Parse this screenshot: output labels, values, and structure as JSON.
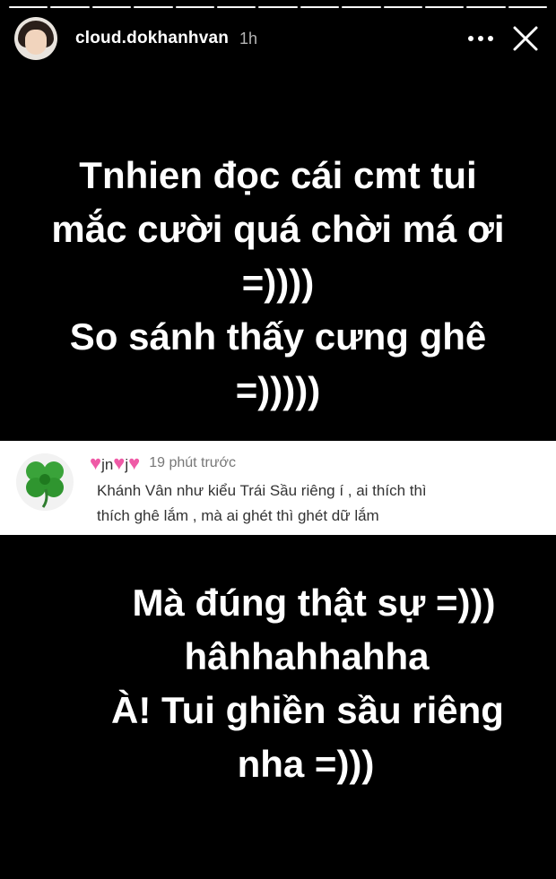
{
  "story": {
    "segments": 13,
    "active_segment": 13,
    "username": "cloud.dokhanhvan",
    "time_ago": "1h",
    "more_icon": "more-horizontal-icon",
    "close_icon": "close-icon"
  },
  "text_top": {
    "lines": [
      "Tnhien đọc cái cmt tui",
      "mắc cười quá chời má ơi",
      "=))))",
      "So sánh thấy cưng ghê",
      "=)))))"
    ]
  },
  "comment": {
    "username_letters": [
      "jn",
      "j"
    ],
    "time_ago": "19 phút trước",
    "body_lines": [
      "Khánh Vân như kiểu Trái Sầu riêng í , ai thích thì",
      "thích ghê lắm , mà ai ghét thì ghét dữ lắm"
    ],
    "heart_color": "#ef5aa6",
    "avatar_icon": "four-leaf-clover-icon"
  },
  "text_bottom": {
    "lines": [
      "Mà đúng thật sự =)))",
      "hâhhahhahha",
      "À! Tui ghiền sầu riêng",
      "nha =)))"
    ]
  }
}
